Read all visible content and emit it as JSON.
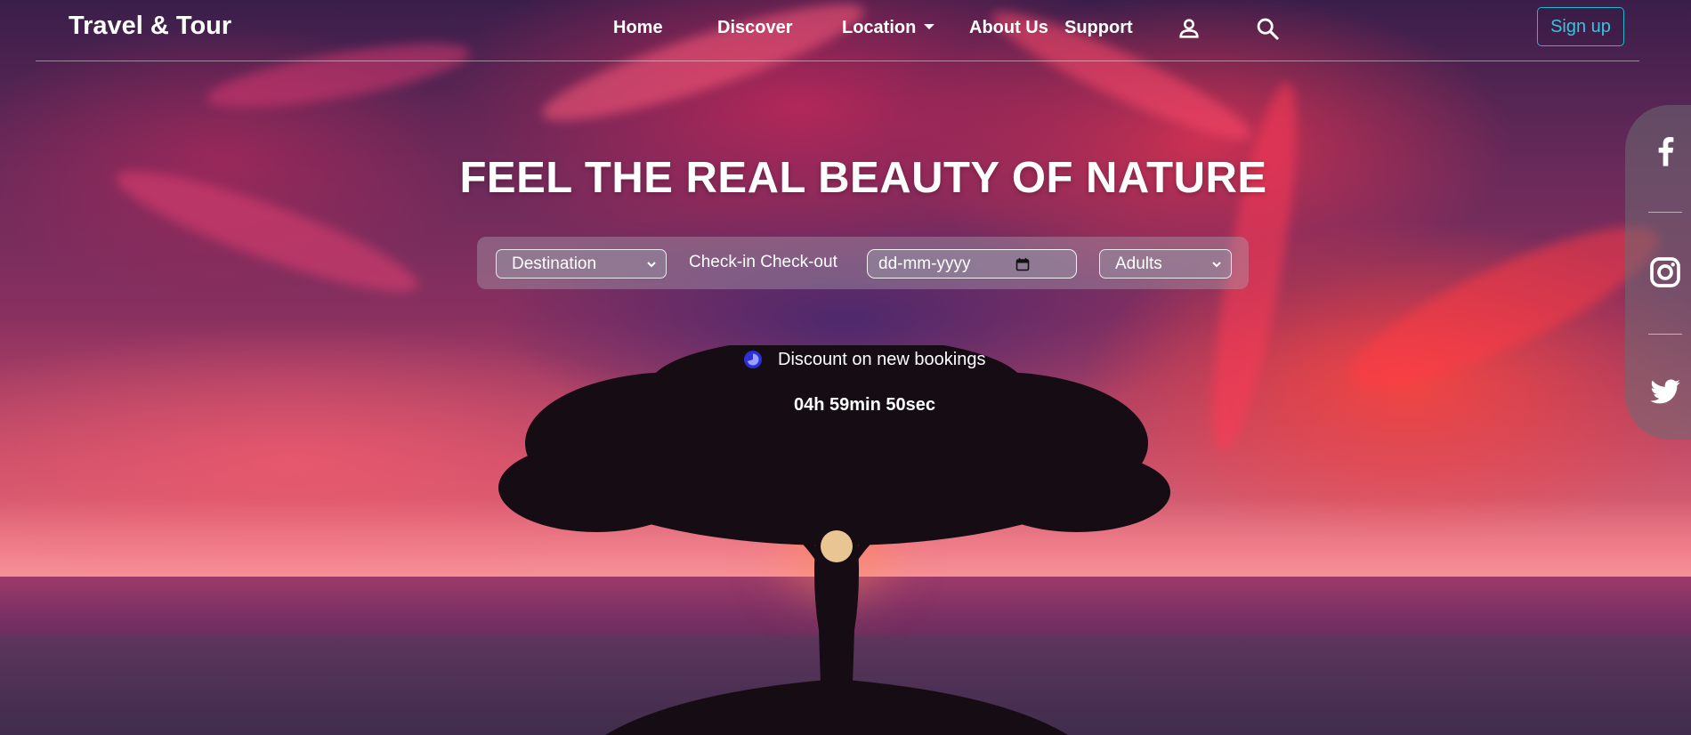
{
  "header": {
    "brand": "Travel & Tour",
    "nav": {
      "home": "Home",
      "discover": "Discover",
      "location": "Location",
      "about": "About Us",
      "support": "Support"
    },
    "icons": [
      "user-icon",
      "search-icon"
    ],
    "signup_label": "Sign up",
    "signup_color": "#22b8cf"
  },
  "hero": {
    "title": "FEEL THE REAL BEAUTY OF NATURE",
    "search": {
      "destination": "Destination",
      "checkin_label": "Check-in Check-out",
      "date_placeholder": "dd-mm-yyyy",
      "adults": "Adults"
    },
    "discount": {
      "icon": "clock-icon",
      "text": "Discount on new bookings",
      "countdown": "04h 59min 50sec"
    }
  },
  "social": [
    "facebook-icon",
    "instagram-icon",
    "twitter-icon"
  ]
}
